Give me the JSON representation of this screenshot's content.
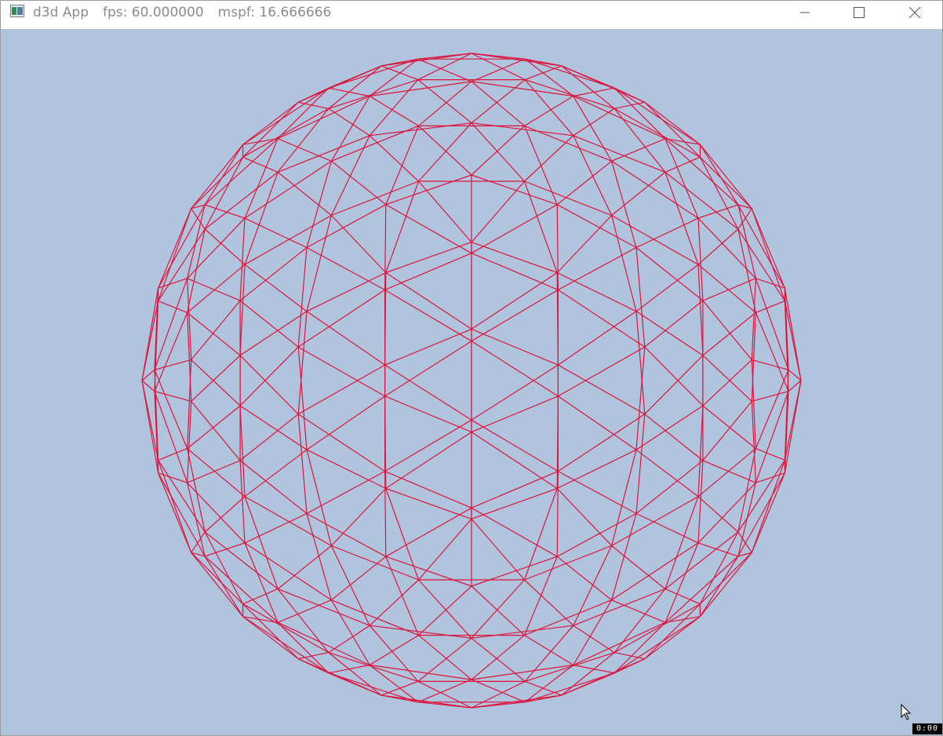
{
  "window": {
    "app_name": "d3d App",
    "fps_text": "fps: 60.000000",
    "mspf_text": "mspf: 16.666666",
    "controls": {
      "minimize": "minimize-icon",
      "maximize": "maximize-icon",
      "close": "close-icon"
    }
  },
  "scene": {
    "background_color": "#b0c4de",
    "wireframe_color": "#dc143c",
    "object": "geodesic-sphere-wireframe"
  },
  "overlay": {
    "timer_text": "0:00"
  }
}
